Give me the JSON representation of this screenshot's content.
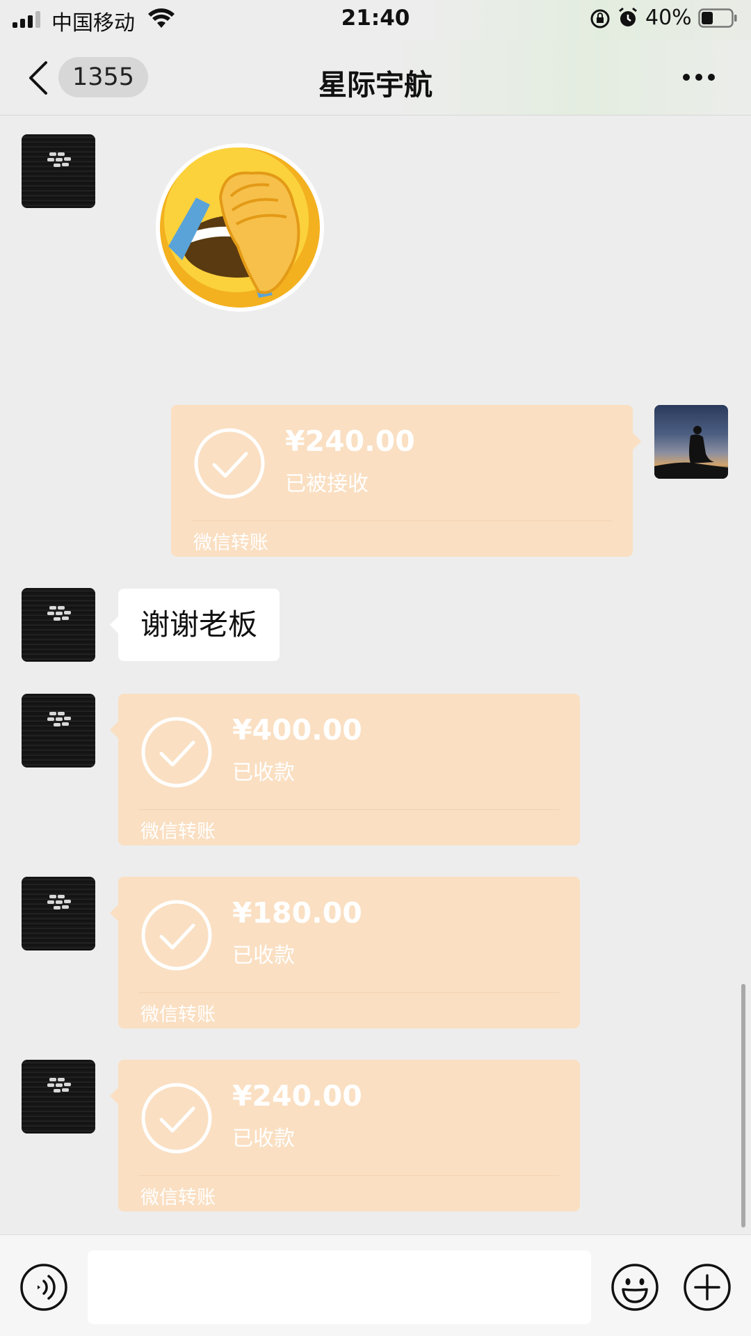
{
  "status_bar": {
    "carrier": "中国移动",
    "time": "21:40",
    "battery": "40%",
    "battery_level": 0.4
  },
  "nav": {
    "unread_count": "1355",
    "title": "星际宇航"
  },
  "messages": [
    {
      "type": "sticker",
      "from": "other",
      "sticker": "facepalm-laughing-emoji"
    },
    {
      "type": "transfer",
      "from": "me",
      "amount": "¥240.00",
      "status": "已被接收",
      "label": "微信转账"
    },
    {
      "type": "text",
      "from": "other",
      "text": "谢谢老板"
    },
    {
      "type": "transfer",
      "from": "other",
      "amount": "¥400.00",
      "status": "已收款",
      "label": "微信转账"
    },
    {
      "type": "transfer",
      "from": "other",
      "amount": "¥180.00",
      "status": "已收款",
      "label": "微信转账"
    },
    {
      "type": "transfer",
      "from": "other",
      "amount": "¥240.00",
      "status": "已收款",
      "label": "微信转账"
    }
  ],
  "input_bar": {
    "placeholder": ""
  },
  "colors": {
    "background": "#ededed",
    "transfer_bubble": "#fadfc2",
    "text_bubble": "#ffffff"
  }
}
